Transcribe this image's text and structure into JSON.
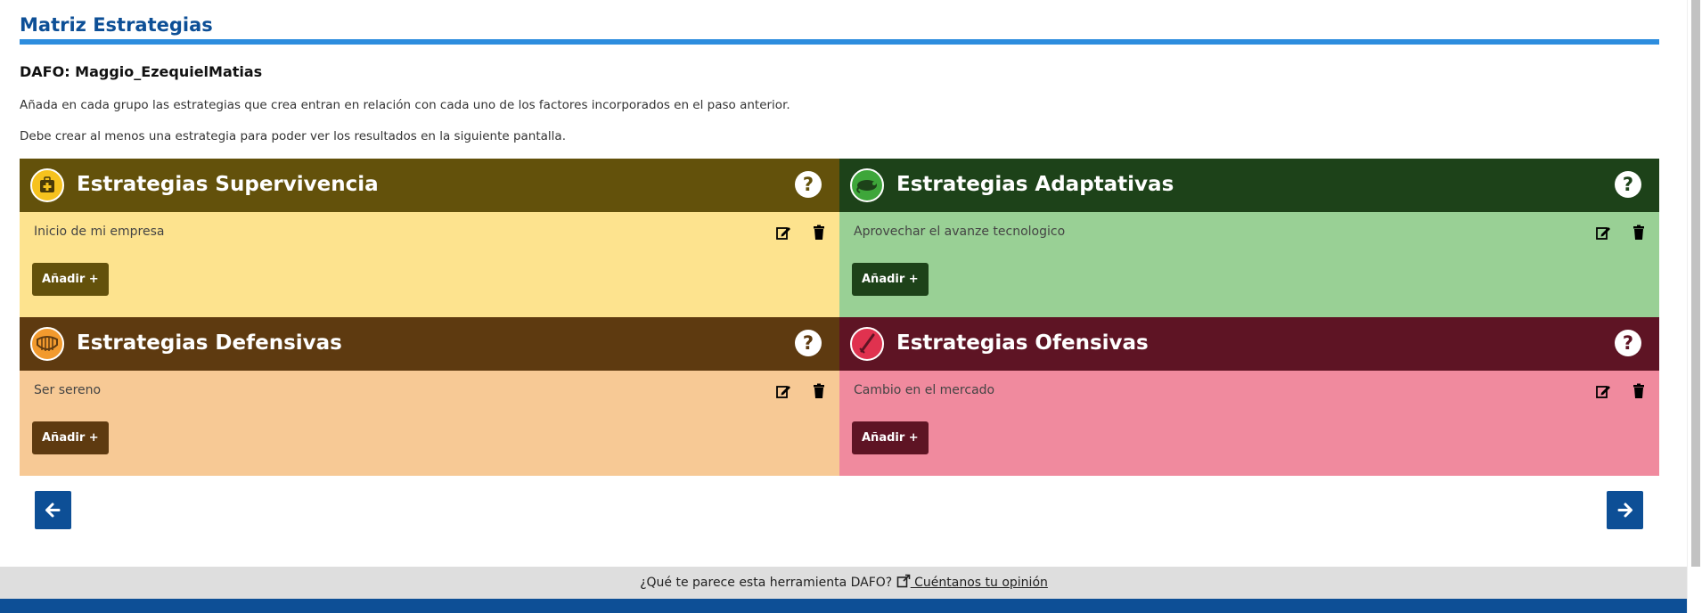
{
  "page": {
    "title": "Matriz Estrategias",
    "dafo_label": "DAFO: Maggio_EzequielMatias",
    "instructions": [
      "Añada en cada grupo las estrategias que crea entran en relación con cada uno de los factores incorporados en el paso anterior.",
      "Debe crear al menos una estrategia para poder ver los resultados en la siguiente pantalla."
    ]
  },
  "quadrants": [
    {
      "title": "Estrategias Supervivencia",
      "items": [
        "Inicio de mi empresa"
      ],
      "add_label": "Añadir +",
      "help": "?",
      "icon": "first-aid-kit-icon",
      "head_color": "#63510b",
      "body_color": "#fde38e",
      "btn_color": "#63510b"
    },
    {
      "title": "Estrategias Adaptativas",
      "items": [
        "Aprovechar el avanze tecnologico"
      ],
      "add_label": "Añadir +",
      "help": "?",
      "icon": "chameleon-icon",
      "head_color": "#1d4219",
      "body_color": "#99d095",
      "btn_color": "#1d4219"
    },
    {
      "title": "Estrategias Defensivas",
      "items": [
        "Ser sereno"
      ],
      "add_label": "Añadir +",
      "help": "?",
      "icon": "armadillo-shell-icon",
      "head_color": "#5e3a10",
      "body_color": "#f7c995",
      "btn_color": "#5e3a10"
    },
    {
      "title": "Estrategias Ofensivas",
      "items": [
        "Cambio en el mercado"
      ],
      "add_label": "Añadir +",
      "help": "?",
      "icon": "sword-icon",
      "head_color": "#5e1424",
      "body_color": "#f08a9e",
      "btn_color": "#5e1424"
    }
  ],
  "navigation": {
    "back": "arrow-left-icon",
    "next": "arrow-right-icon"
  },
  "feedback": {
    "question": "¿Qué te parece esta herramienta DAFO?",
    "link": " Cuéntanos tu opinión",
    "icon": "external-link-icon"
  }
}
